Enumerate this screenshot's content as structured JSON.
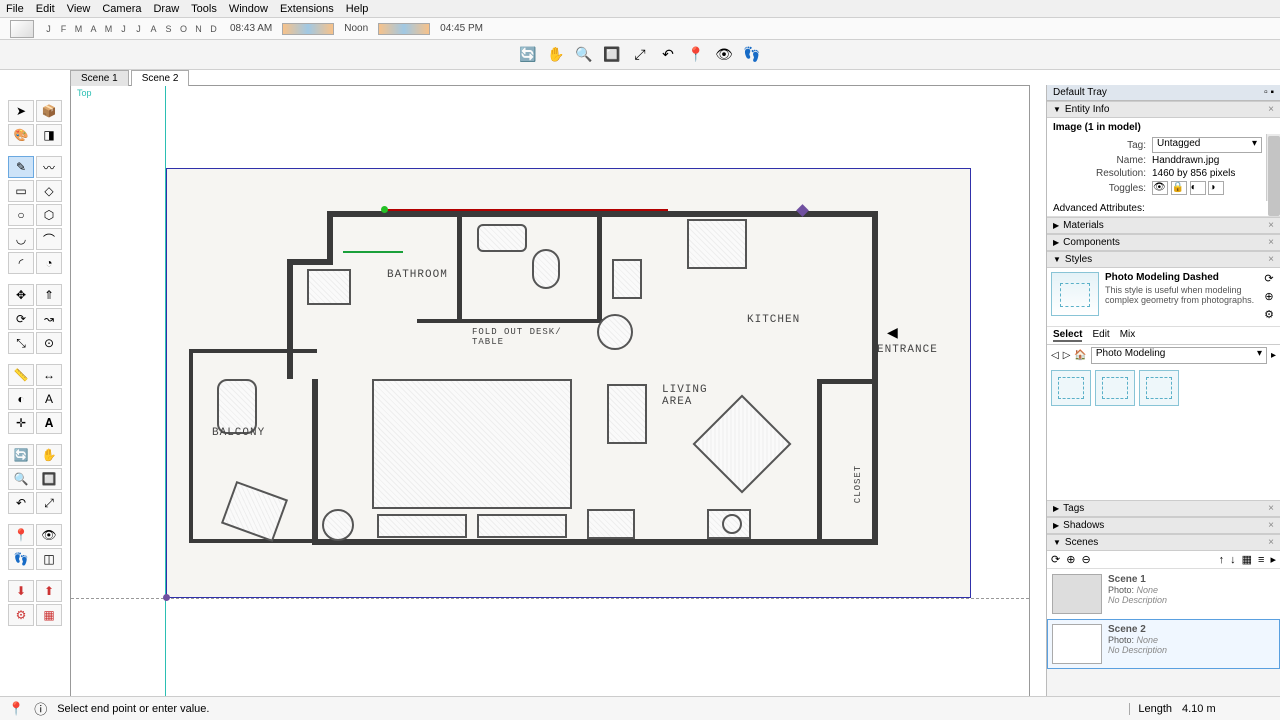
{
  "menu": [
    "File",
    "Edit",
    "View",
    "Camera",
    "Draw",
    "Tools",
    "Window",
    "Extensions",
    "Help"
  ],
  "months": [
    "J",
    "F",
    "M",
    "A",
    "M",
    "J",
    "J",
    "A",
    "S",
    "O",
    "N",
    "D"
  ],
  "time": {
    "morning": "08:43 AM",
    "noon": "Noon",
    "afternoon": "04:45 PM"
  },
  "scenes_tabs": {
    "s1": "Scene 1",
    "s2": "Scene 2"
  },
  "viewport": {
    "orientation": "Top"
  },
  "floorplan_labels": {
    "bathroom": "BATHROOM",
    "fold": "FOLD OUT DESK/\nTABLE",
    "kitchen": "KITCHEN",
    "entrance": "ENTRANCE",
    "living": "LIVING\nAREA",
    "balcony": "BALCONY",
    "closet": "CLOSET"
  },
  "tray": {
    "title": "Default Tray",
    "entity_info": {
      "header": "Entity Info",
      "selection": "Image (1 in model)",
      "tag_label": "Tag:",
      "tag_value": "Untagged",
      "name_label": "Name:",
      "name_value": "Handdrawn.jpg",
      "res_label": "Resolution:",
      "res_value": "1460 by 856 pixels",
      "toggles_label": "Toggles:",
      "adv": "Advanced Attributes:"
    },
    "materials": "Materials",
    "components": "Components",
    "styles": {
      "header": "Styles",
      "name": "Photo Modeling Dashed",
      "desc": "This style is useful when modeling complex geometry from photographs.",
      "tabs": {
        "select": "Select",
        "edit": "Edit",
        "mix": "Mix"
      },
      "dropdown": "Photo Modeling"
    },
    "tags": "Tags",
    "shadows": "Shadows",
    "scenes": {
      "header": "Scenes",
      "scene1": {
        "name": "Scene 1",
        "photo": "Photo:",
        "photo_v": "None",
        "desc": "No Description"
      },
      "scene2": {
        "name": "Scene 2",
        "photo": "Photo:",
        "photo_v": "None",
        "desc": "No Description"
      }
    }
  },
  "status": {
    "hint": "Select end point or enter value.",
    "length_label": "Length",
    "length_value": "4.10 m"
  }
}
